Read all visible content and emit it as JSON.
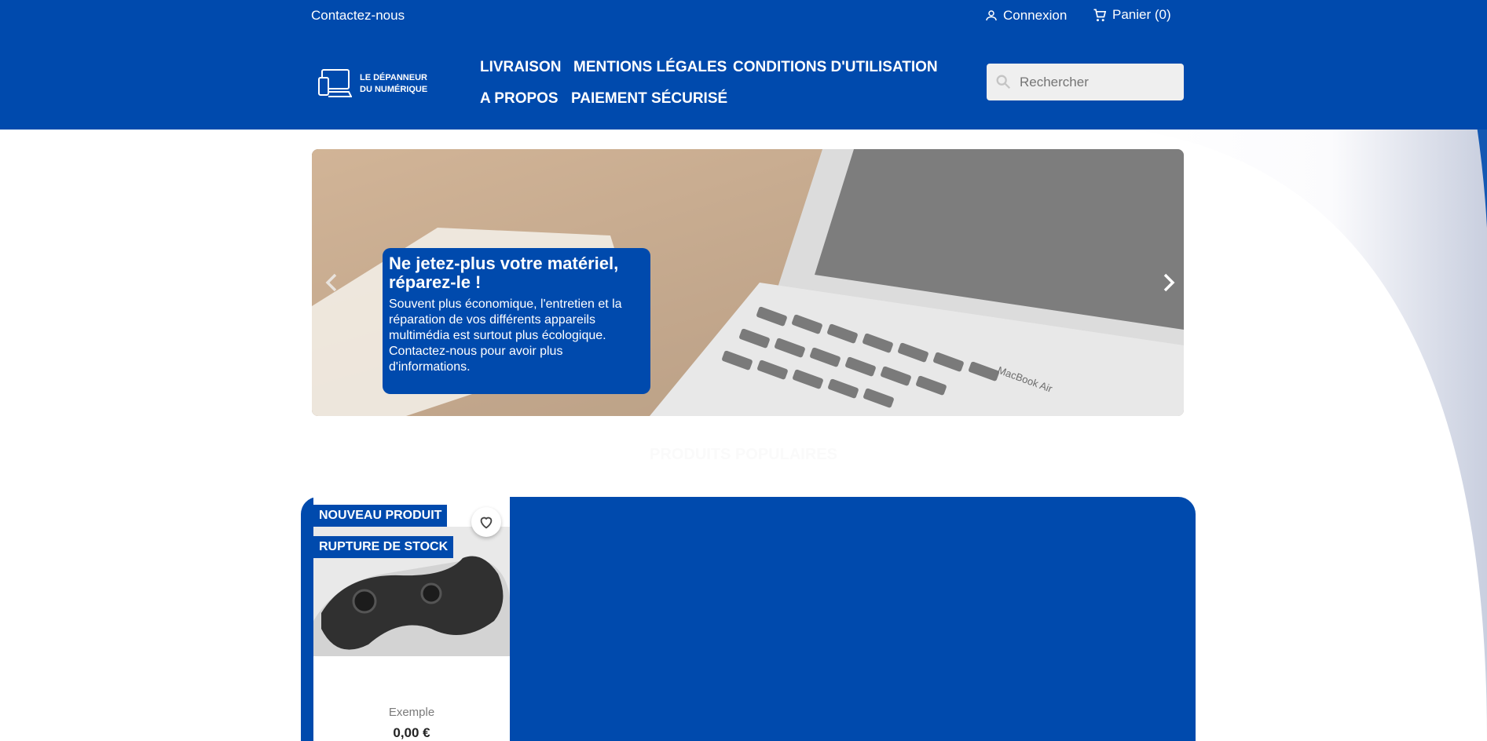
{
  "colors": {
    "brand": "#004aad",
    "white": "#ffffff",
    "search_bg": "#efefef"
  },
  "topbar": {
    "contact_label": "Contactez-nous",
    "login_label": "Connexion",
    "cart_label": "Panier (0)",
    "login_icon": "user-icon",
    "cart_icon": "cart-icon"
  },
  "logo": {
    "line1": "LE DÉPANNEUR",
    "line2": "DU NUMÉRIQUE",
    "icon": "devices-icon"
  },
  "menu": {
    "items": [
      {
        "label": "LIVRAISON"
      },
      {
        "label": "MENTIONS LÉGALES"
      },
      {
        "label": "CONDITIONS D'UTILISATION"
      },
      {
        "label": "A PROPOS"
      },
      {
        "label": "PAIEMENT SÉCURISÉ"
      }
    ]
  },
  "search": {
    "placeholder": "Rechercher",
    "icon": "search-icon"
  },
  "slider": {
    "title": "Ne jetez-plus votre matériel, réparez-le !",
    "text": "Souvent plus économique, l'entretien et la réparation de vos différents appareils multimédia est surtout plus écologique. Contactez-nous pour avoir plus d'informations.",
    "brand_mark": "MacBook Air",
    "prev_icon": "chevron-left-icon",
    "next_icon": "chevron-right-icon"
  },
  "section": {
    "title": "PRODUITS POPULAIRES"
  },
  "product": {
    "flag_new": "NOUVEAU PRODUIT",
    "flag_oos": "RUPTURE DE STOCK",
    "name": "Exemple",
    "price": "0,00 €",
    "wish_icon": "heart-icon"
  }
}
